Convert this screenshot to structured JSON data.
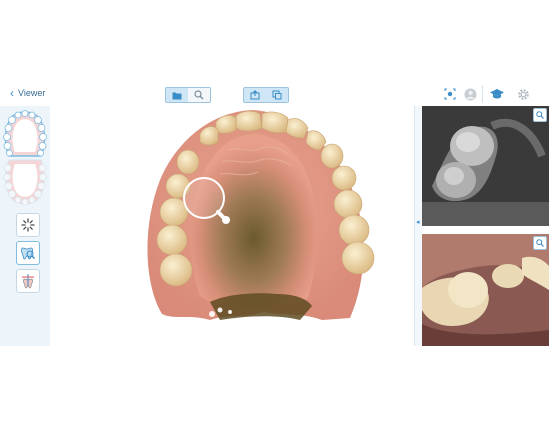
{
  "header": {
    "back_label": "Viewer"
  },
  "toolbar": {
    "view_icons": [
      "folder-icon",
      "magnify-icon"
    ],
    "action_icons": [
      "share-icon",
      "snapshot-icon"
    ],
    "right_icons": [
      "camera-icon",
      "user-avatar-icon",
      "learning-icon",
      "gear-icon"
    ]
  },
  "left_tools": [
    "jaw-overview-map",
    "sparkle-tool-icon",
    "tooth-review-tool-icon",
    "axis-tool-icon"
  ],
  "thumbnails": [
    "near-infrared-image",
    "color-intraoral-image"
  ],
  "colors": {
    "accent": "#3a8cc6",
    "active_toggle": "#cfe6f6",
    "panel_bg": "#eef5fa"
  }
}
